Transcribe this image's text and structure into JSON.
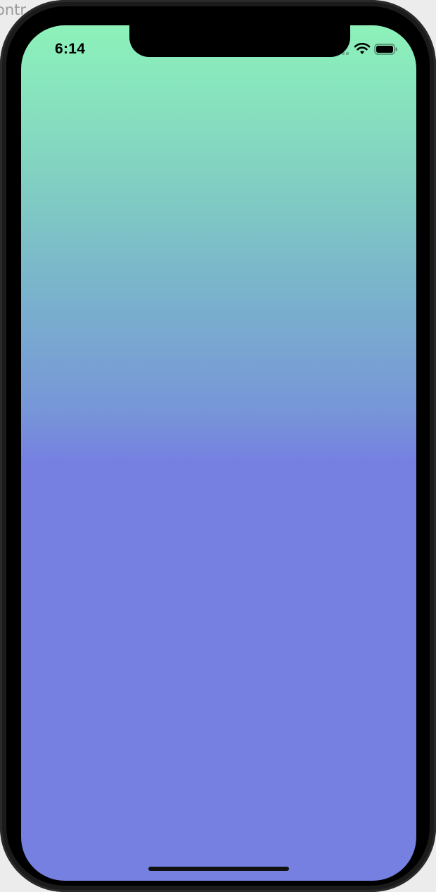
{
  "backdrop": {
    "fragment_text": "ontr"
  },
  "status_bar": {
    "time": "6:14",
    "icons": [
      "cellular-signal-icon",
      "wifi-icon",
      "battery-icon"
    ]
  },
  "screen": {
    "gradient_top_color": "#8df2ba",
    "gradient_bottom_color": "#7580e0"
  }
}
